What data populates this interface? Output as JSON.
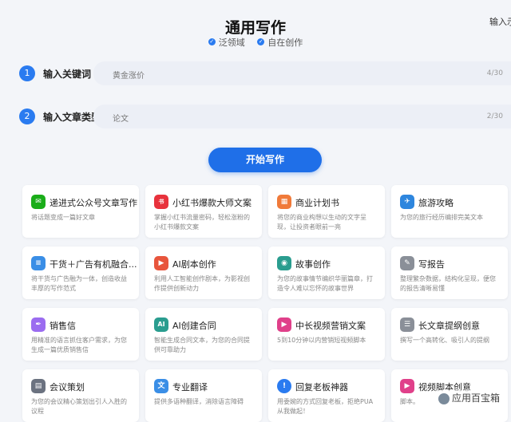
{
  "header": {
    "title": "通用写作",
    "tags": [
      "泛领域",
      "自在创作"
    ],
    "corner_text": "输入示"
  },
  "form": {
    "step1": {
      "number": "1",
      "label": "输入关键词",
      "value": "黄金涨价",
      "counter": "4/30"
    },
    "step2": {
      "number": "2",
      "label": "输入文章类型",
      "value": "论文",
      "counter": "2/30"
    },
    "start_label": "开始写作"
  },
  "cards": [
    {
      "title": "递进式公众号文章写作",
      "desc": "将话题变成一篇好文章",
      "icon": "wechat-icon",
      "color": "#1aad19"
    },
    {
      "title": "小红书爆款大师文案",
      "desc": "掌握小红书流量密码，轻松涨粉的小红书爆款文案",
      "icon": "xiaohongshu-icon",
      "color": "#e8323c"
    },
    {
      "title": "商业计划书",
      "desc": "将您的商业构想以生动的文字呈现，让投资者眼前一亮",
      "icon": "building-icon",
      "color": "#f07a3a"
    },
    {
      "title": "旅游攻略",
      "desc": "为您的旅行经历编排完美文本",
      "icon": "travel-icon",
      "color": "#2e86de"
    },
    {
      "title": "干货＋广告有机融合...",
      "desc": "将干货与广告融为一体，创造收益丰厚的写作范式",
      "icon": "document-icon",
      "color": "#3a8ee6"
    },
    {
      "title": "AI剧本创作",
      "desc": "利用人工智能创作剧本，为影视创作提供创新动力",
      "icon": "film-icon",
      "color": "#e8553c"
    },
    {
      "title": "故事创作",
      "desc": "为您的故事情节编织华丽篇章，打造令人难以忘怀的故事世界",
      "icon": "globe-icon",
      "color": "#2a9d8f"
    },
    {
      "title": "写报告",
      "desc": "整理繁杂数据，结构化呈现，便您的报告清晰易懂",
      "icon": "report-icon",
      "color": "#8a8f98"
    },
    {
      "title": "销售信",
      "desc": "用精准的语言抓住客户需求，为您生成一篇优质销售信",
      "icon": "pen-icon",
      "color": "#9b6cf0"
    },
    {
      "title": "AI创建合同",
      "desc": "智能生成合同文本，为您的合同提供可靠助力",
      "icon": "ai-icon",
      "color": "#2a9d8f"
    },
    {
      "title": "中长视频营销文案",
      "desc": "5到10分钟以内营销短视频脚本",
      "icon": "video-icon",
      "color": "#e0408a"
    },
    {
      "title": "长文章提纲创意",
      "desc": "撰写一个高转化、吸引人的提纲",
      "icon": "outline-icon",
      "color": "#8a8f98"
    },
    {
      "title": "会议策划",
      "desc": "为您的会议精心策划出引人入胜的议程",
      "icon": "meeting-icon",
      "color": "#6b7280"
    },
    {
      "title": "专业翻译",
      "desc": "提供多语种翻译，消除语言障碍",
      "icon": "translate-icon",
      "color": "#3a8ee6"
    },
    {
      "title": "回复老板神器",
      "desc": "用委婉的方式回复老板，拒绝PUA从我做起！",
      "icon": "info-icon",
      "color": "#2a7bf0"
    },
    {
      "title": "视频脚本创意",
      "desc": "脚本。",
      "icon": "video-script-icon",
      "color": "#e0408a"
    }
  ],
  "watermark": "应用百宝箱"
}
